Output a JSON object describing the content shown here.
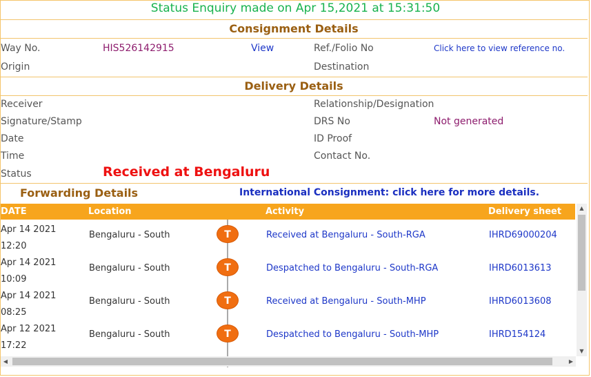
{
  "status_enquiry": "Status Enquiry made on Apr 15,2021 at 15:31:50",
  "consignment": {
    "heading": "Consignment Details",
    "way_no_label": "Way No.",
    "way_no_value": "HIS526142915",
    "view_link": "View",
    "ref_label": "Ref./Folio No",
    "ref_link": "Click here to view reference no.",
    "origin_label": "Origin",
    "destination_label": "Destination"
  },
  "delivery": {
    "heading": "Delivery Details",
    "receiver_label": "Receiver",
    "relationship_label": "Relationship/Designation",
    "signature_label": "Signature/Stamp",
    "drs_label": "DRS No",
    "drs_value": "Not generated",
    "date_label": "Date",
    "id_proof_label": "ID Proof",
    "time_label": "Time",
    "contact_label": "Contact No.",
    "status_label": "Status",
    "status_value": "Received at Bengaluru"
  },
  "forwarding": {
    "heading": "Forwarding Details",
    "intl_link": "International Consignment: click here for more details.",
    "columns": [
      "DATE",
      "Location",
      "Activity",
      "Delivery sheet"
    ],
    "rows": [
      {
        "date": "Apr 14 2021",
        "time": "12:20",
        "location": "Bengaluru - South",
        "badge": "T",
        "activity": "Received at Bengaluru - South-RGA",
        "sheet": "IHRD69000204"
      },
      {
        "date": "Apr 14 2021",
        "time": "10:09",
        "location": "Bengaluru - South",
        "badge": "T",
        "activity": "Despatched to Bengaluru - South-RGA",
        "sheet": "IHRD6013613"
      },
      {
        "date": "Apr 14 2021",
        "time": "08:25",
        "location": "Bengaluru - South",
        "badge": "T",
        "activity": "Received at Bengaluru - South-MHP",
        "sheet": "IHRD6013608"
      },
      {
        "date": "Apr 12 2021",
        "time": "17:22",
        "location": "Bengaluru - South",
        "badge": "T",
        "activity": "Despatched to Bengaluru - South-MHP",
        "sheet": "IHRD154124"
      }
    ]
  },
  "scroll": {
    "up": "▲",
    "down": "▼",
    "left": "◀",
    "right": "▶"
  },
  "colors": {
    "header_bg": "#f7a51d",
    "badge": "#f06e11",
    "status_red": "#ee1111",
    "heading_brown": "#9a5f12"
  }
}
